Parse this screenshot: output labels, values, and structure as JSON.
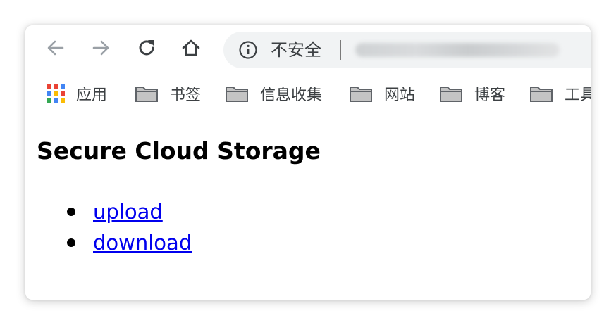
{
  "browser": {
    "security_label": "不安全",
    "bookmarks": [
      {
        "label": "应用",
        "icon": "apps-icon"
      },
      {
        "label": "书签",
        "icon": "folder-icon"
      },
      {
        "label": "信息收集",
        "icon": "folder-icon"
      },
      {
        "label": "网站",
        "icon": "folder-icon"
      },
      {
        "label": "博客",
        "icon": "folder-icon"
      },
      {
        "label": "工具",
        "icon": "folder-icon"
      }
    ],
    "colors": {
      "omnibox_bg": "#f1f3f4",
      "icon_gray": "#5f6368",
      "disabled_gray": "#9aa0a6"
    }
  },
  "page": {
    "title": "Secure Cloud Storage",
    "links": [
      {
        "label": "upload"
      },
      {
        "label": "download"
      }
    ],
    "link_color": "#0000ee"
  }
}
